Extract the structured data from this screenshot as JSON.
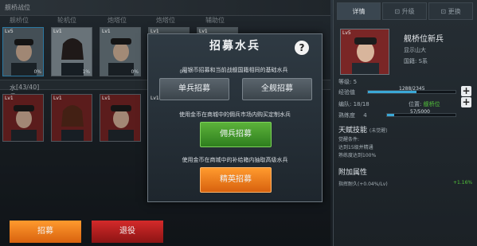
{
  "header": {
    "title": "舰桥战位"
  },
  "slot_labels": [
    "舰桥位",
    "轮机位",
    "炮塔位",
    "炮塔位",
    "辅助位"
  ],
  "slots": [
    {
      "lv": "Lv5",
      "pct": "0%"
    },
    {
      "lv": "Lv1",
      "pct": "1%"
    },
    {
      "lv": "Lv1",
      "pct": "0%"
    },
    {
      "lv": "Lv1",
      "pct": "0%"
    },
    {
      "lv": "Lv1",
      "pct": ""
    }
  ],
  "reserve": {
    "title": "水兵预备",
    "count": "[43/40]"
  },
  "reserve_cards": [
    {
      "lv": "Lv1"
    },
    {
      "lv": "Lv1"
    },
    {
      "lv": "Lv1"
    },
    {
      "lv": "Lv1"
    }
  ],
  "modal": {
    "title": "招募水兵",
    "help_icon": "?",
    "desc1": "用银币招募和当前战舰国籍相同的基础水兵",
    "btn_single": "单兵招募",
    "btn_full": "全舰招募",
    "desc2": "使用金币在商城中的佣兵市场内购买定制水兵",
    "btn_merc": "佣兵招募",
    "desc3": "使用金币在商城中的补给箱内抽取高级水兵",
    "btn_elite": "精英招募"
  },
  "right_panel": {
    "tabs": [
      "详情",
      "升级",
      "更换"
    ],
    "tab_icons": [
      "",
      "lock-icon",
      "lock-icon"
    ],
    "card_lv": "Lv5",
    "name": "舰桥位新兵",
    "line1": "显示山大",
    "line2": "国籍: S系",
    "level_label": "等级: 5",
    "exp_label": "经验值",
    "exp_value": "1288/2345",
    "exp_fill": 0.55,
    "rank_label": "编队: 18/18",
    "pos_label": "位置:",
    "pos_value": "舰桥位",
    "skill_label": "熟练度",
    "skill_value": "4",
    "skill_bar_text": "57/5000",
    "skill_fill": 0.1,
    "talent_title": "天赋技能",
    "talent_note": "(未觉醒)",
    "talent_lines": [
      "觉醒条件:",
      "达到15级并精通",
      "熟练度达到100%"
    ],
    "attr_title": "附加属性",
    "attr_name": "指挥耐久(+0.04%/Lv)",
    "attr_value": "+1.16%"
  },
  "bottom": {
    "recruit": "招募",
    "retire": "退役"
  },
  "colors": {
    "accent": "#3aa0d8",
    "green": "#5cb23a",
    "orange": "#ff8a24",
    "red": "#c81e1e"
  }
}
